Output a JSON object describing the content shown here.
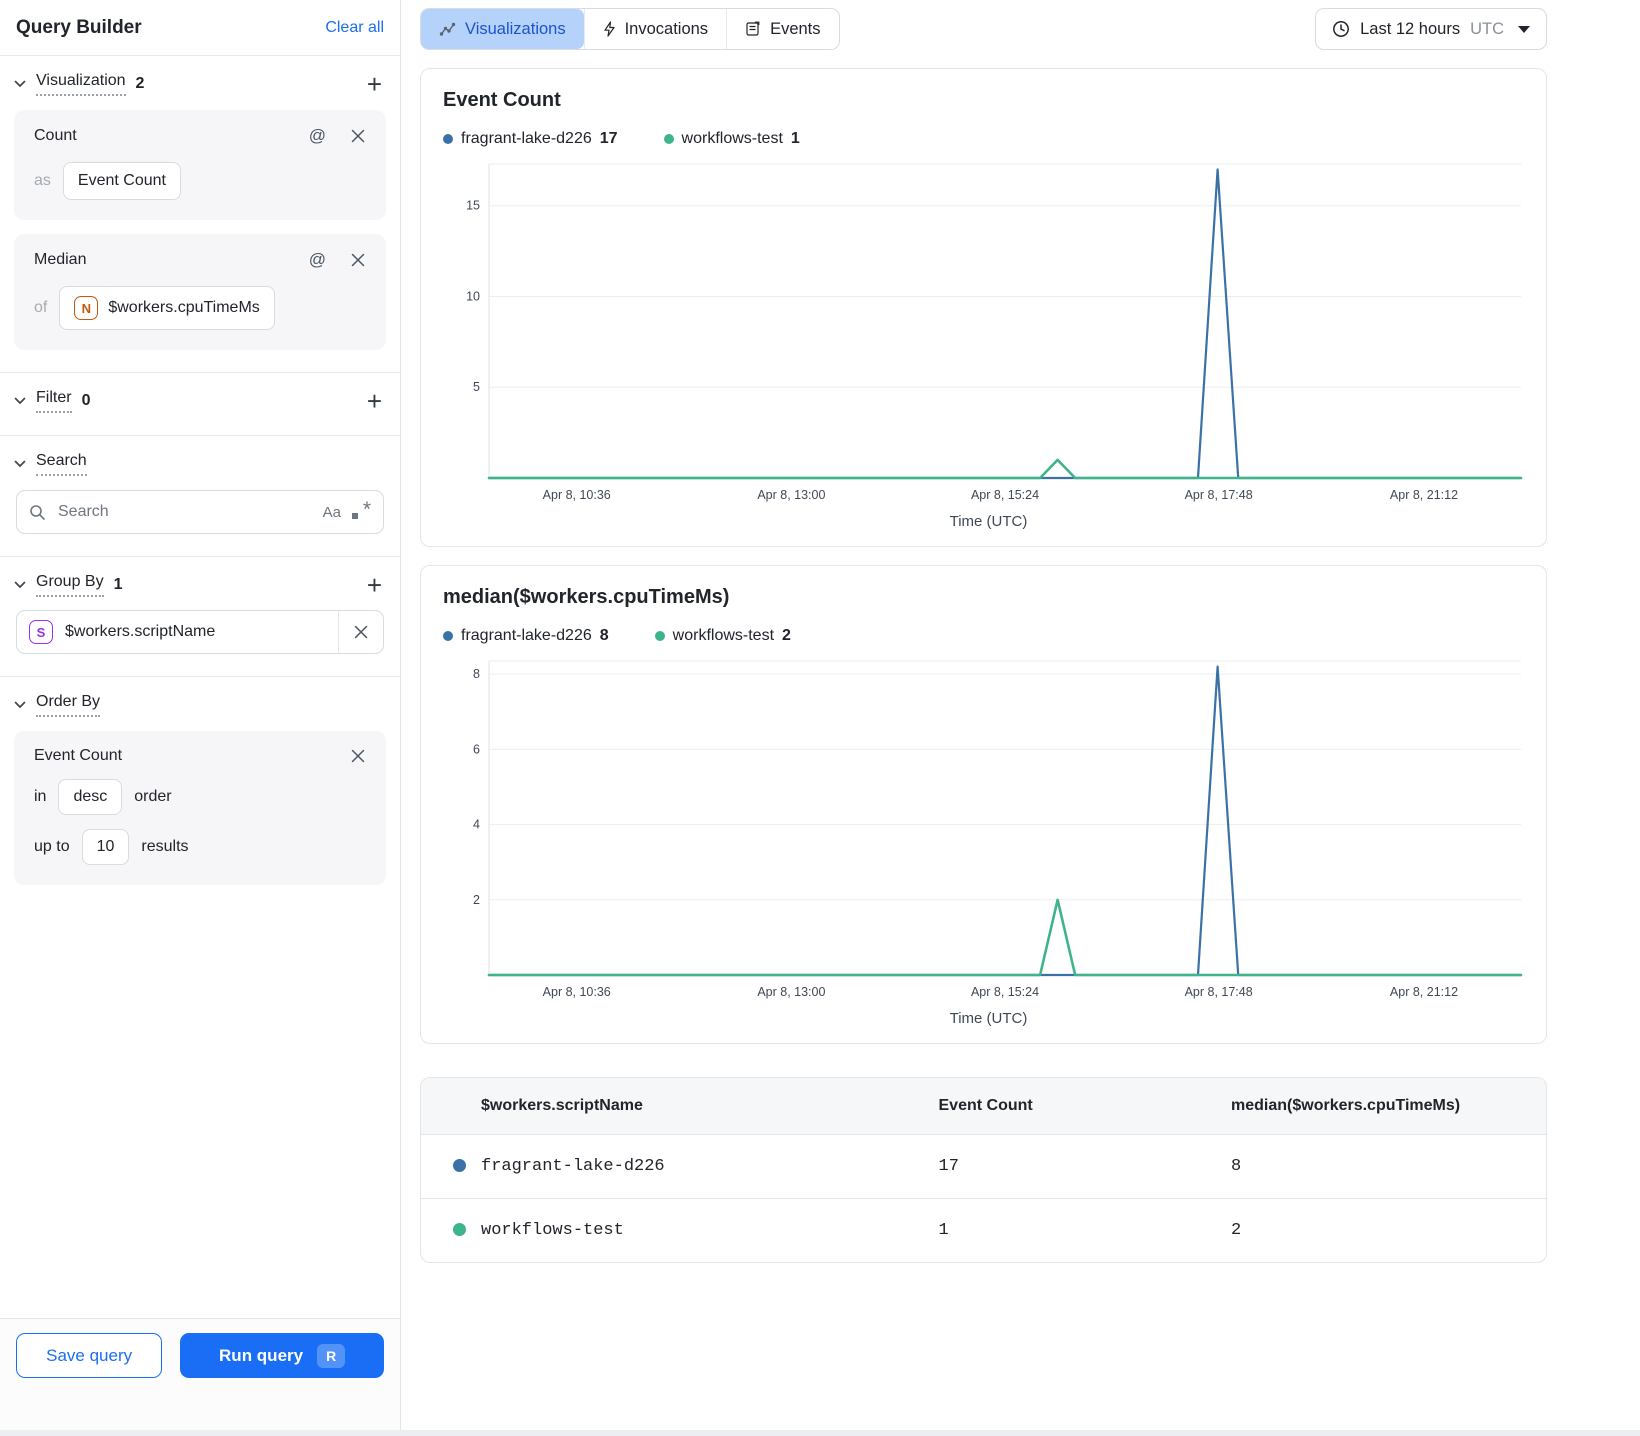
{
  "sidebar": {
    "title": "Query Builder",
    "clear_all_label": "Clear all",
    "sections": {
      "visualization": {
        "label": "Visualization",
        "count": "2"
      },
      "filter": {
        "label": "Filter",
        "count": "0"
      },
      "search": {
        "label": "Search"
      },
      "group_by": {
        "label": "Group By",
        "count": "1"
      },
      "order_by": {
        "label": "Order By"
      }
    },
    "count_card": {
      "title": "Count",
      "as_label": "as",
      "alias": "Event Count"
    },
    "median_card": {
      "title": "Median",
      "of_label": "of",
      "field": "$workers.cpuTimeMs",
      "field_icon_letter": "N"
    },
    "search_input": {
      "placeholder": "Search",
      "match_case_label": "Aa"
    },
    "group_by_item": {
      "field": "$workers.scriptName",
      "field_icon_letter": "S"
    },
    "order_by_item": {
      "title": "Event Count",
      "in_label": "in",
      "direction": "desc",
      "order_label": "order",
      "up_to_label": "up to",
      "limit": "10",
      "results_label": "results"
    },
    "footer": {
      "save_label": "Save query",
      "run_label": "Run query",
      "run_shortcut": "R"
    }
  },
  "header": {
    "tabs": [
      {
        "label": "Visualizations",
        "icon": "chart-line-icon",
        "active": true
      },
      {
        "label": "Invocations",
        "icon": "lightning-icon",
        "active": false
      },
      {
        "label": "Events",
        "icon": "document-icon",
        "active": false
      }
    ],
    "time_range": {
      "label": "Last 12 hours",
      "timezone": "UTC"
    }
  },
  "chart_data": [
    {
      "type": "line",
      "title": "Event Count",
      "xlabel": "Time (UTC)",
      "x_ticks": [
        "Apr 8, 10:36",
        "Apr 8, 13:00",
        "Apr 8, 15:24",
        "Apr 8, 17:48",
        "Apr 8, 21:12"
      ],
      "x_tick_fractions": [
        0.085,
        0.293,
        0.5,
        0.707,
        0.906
      ],
      "y_ticks": [
        5,
        10,
        15
      ],
      "ylim": [
        0,
        17.3
      ],
      "grid": true,
      "legend_position": "top",
      "legend": [
        {
          "name": "fragrant-lake-d226",
          "total": "17",
          "color": "#3a72a8"
        },
        {
          "name": "workflows-test",
          "total": "1",
          "color": "#3eb48b"
        }
      ],
      "series": [
        {
          "name": "fragrant-lake-d226",
          "color": "#3a72a8",
          "width": 2.2,
          "points": [
            [
              0,
              0
            ],
            [
              0.687,
              0
            ],
            [
              0.706,
              17
            ],
            [
              0.726,
              0
            ],
            [
              1,
              0
            ]
          ]
        },
        {
          "name": "workflows-test",
          "color": "#3eb48b",
          "width": 2.6,
          "points": [
            [
              0,
              0
            ],
            [
              0.534,
              0
            ],
            [
              0.551,
              1
            ],
            [
              0.568,
              0
            ],
            [
              1,
              0
            ]
          ]
        }
      ]
    },
    {
      "type": "line",
      "title": "median($workers.cpuTimeMs)",
      "xlabel": "Time (UTC)",
      "x_ticks": [
        "Apr 8, 10:36",
        "Apr 8, 13:00",
        "Apr 8, 15:24",
        "Apr 8, 17:48",
        "Apr 8, 21:12"
      ],
      "x_tick_fractions": [
        0.085,
        0.293,
        0.5,
        0.707,
        0.906
      ],
      "y_ticks": [
        2,
        4,
        6,
        8
      ],
      "ylim": [
        0,
        8.35
      ],
      "grid": true,
      "legend_position": "top",
      "legend": [
        {
          "name": "fragrant-lake-d226",
          "total": "8",
          "color": "#3a72a8"
        },
        {
          "name": "workflows-test",
          "total": "2",
          "color": "#3eb48b"
        }
      ],
      "series": [
        {
          "name": "fragrant-lake-d226",
          "color": "#3a72a8",
          "width": 2.2,
          "points": [
            [
              0,
              0
            ],
            [
              0.687,
              0
            ],
            [
              0.706,
              8.2
            ],
            [
              0.726,
              0
            ],
            [
              1,
              0
            ]
          ]
        },
        {
          "name": "workflows-test",
          "color": "#3eb48b",
          "width": 2.6,
          "points": [
            [
              0,
              0
            ],
            [
              0.534,
              0
            ],
            [
              0.551,
              2
            ],
            [
              0.568,
              0
            ],
            [
              1,
              0
            ]
          ]
        }
      ]
    }
  ],
  "table": {
    "columns": [
      "$workers.scriptName",
      "Event Count",
      "median($workers.cpuTimeMs)"
    ],
    "rows": [
      {
        "dot_color": "#3a72a8",
        "cells": [
          "fragrant-lake-d226",
          "17",
          "8"
        ]
      },
      {
        "dot_color": "#3eb48b",
        "cells": [
          "workflows-test",
          "1",
          "2"
        ]
      }
    ]
  },
  "colors": {
    "accent_blue": "#1a6ef5",
    "series_blue": "#3a72a8",
    "series_green": "#3eb48b",
    "tab_active_bg": "#b5d2fa",
    "tab_active_text": "#1b55cc"
  }
}
